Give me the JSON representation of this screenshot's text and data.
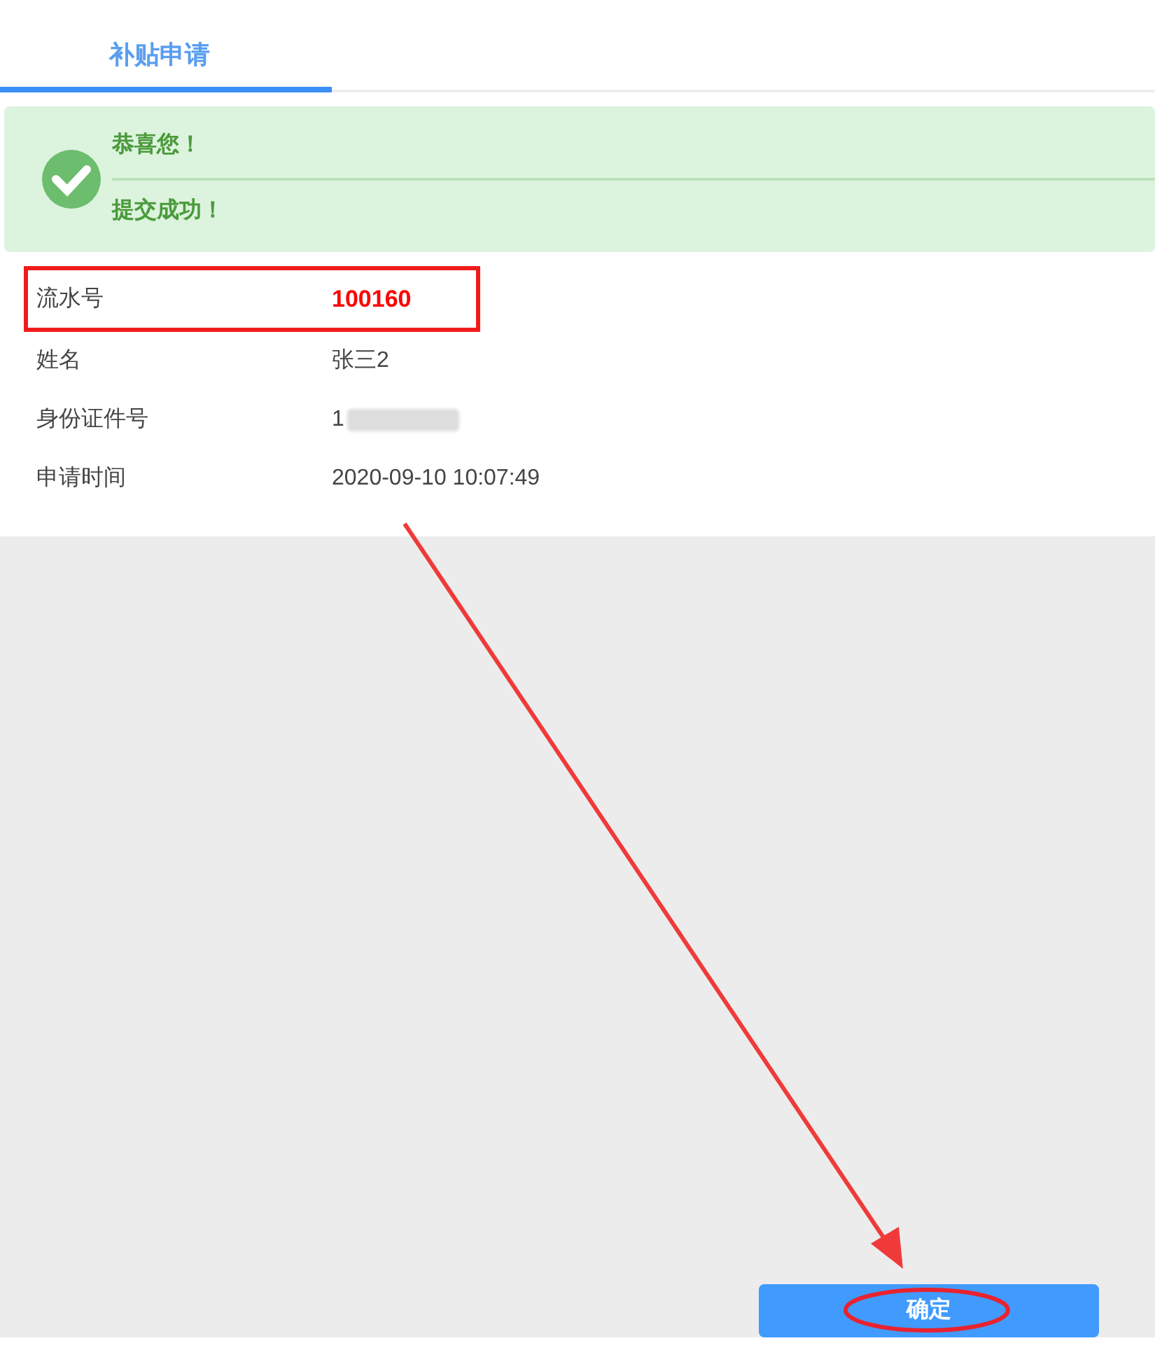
{
  "tabs": [
    {
      "label": "补贴申请",
      "selected": true
    }
  ],
  "alert": {
    "title": "恭喜您！",
    "message": "提交成功！"
  },
  "fields": [
    {
      "label": "流水号",
      "value": "100160",
      "kind": "serial",
      "highlighted": true
    },
    {
      "label": "姓名",
      "value": "张三2",
      "kind": "text",
      "highlighted": false
    },
    {
      "label": "身份证件号",
      "value": "1",
      "kind": "redacted",
      "highlighted": false
    },
    {
      "label": "申请时间",
      "value": "2020-09-10 10:07:49",
      "kind": "text",
      "highlighted": false
    }
  ],
  "confirm_button": {
    "label": "确定",
    "circled": true
  },
  "annotation_arrow": true
}
